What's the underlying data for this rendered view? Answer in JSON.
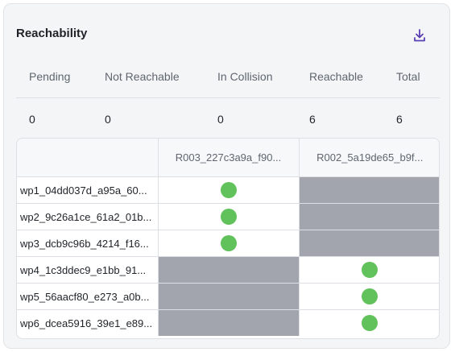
{
  "title": "Reachability",
  "colors": {
    "reachable": "#61c15a",
    "unavailable": "#a2a4ae",
    "accent": "#5b3fb5"
  },
  "icons": {
    "download": "download-icon"
  },
  "summary": {
    "headers": [
      "Pending",
      "Not Reachable",
      "In Collision",
      "Reachable",
      "Total"
    ],
    "values": [
      "0",
      "0",
      "0",
      "6",
      "6"
    ]
  },
  "matrix": {
    "columns": [
      "R003_227c3a9a_f90...",
      "R002_5a19de65_b9f..."
    ],
    "rows": [
      {
        "label": "wp1_04dd037d_a95a_60...",
        "cells": [
          "reachable",
          "unavailable"
        ]
      },
      {
        "label": "wp2_9c26a1ce_61a2_01b...",
        "cells": [
          "reachable",
          "unavailable"
        ]
      },
      {
        "label": "wp3_dcb9c96b_4214_f16...",
        "cells": [
          "reachable",
          "unavailable"
        ]
      },
      {
        "label": "wp4_1c3ddec9_e1bb_91...",
        "cells": [
          "unavailable",
          "reachable"
        ]
      },
      {
        "label": "wp5_56aacf80_e273_a0b...",
        "cells": [
          "unavailable",
          "reachable"
        ]
      },
      {
        "label": "wp6_dcea5916_39e1_e89...",
        "cells": [
          "unavailable",
          "reachable"
        ]
      }
    ]
  }
}
